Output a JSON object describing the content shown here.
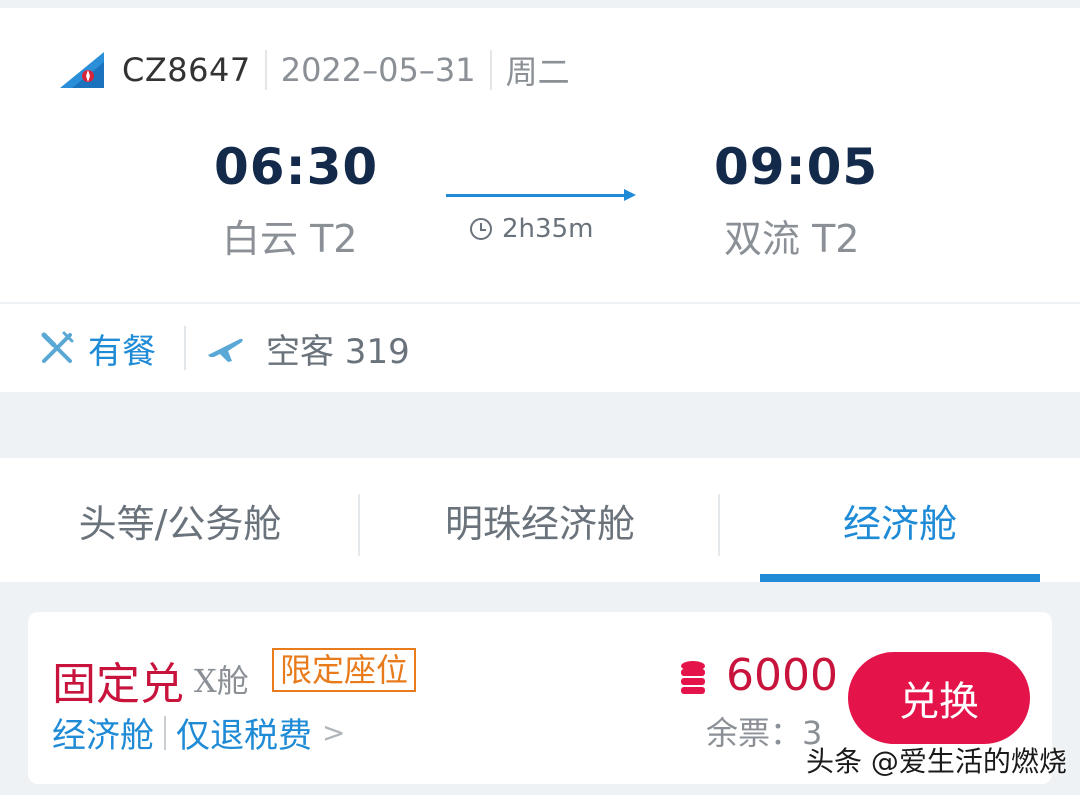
{
  "flight": {
    "number": "CZ8647",
    "date": "2022–05–31",
    "weekday": "周二",
    "departure_time": "06:30",
    "departure_airport": "白云 T2",
    "arrival_time": "09:05",
    "arrival_airport": "双流 T2",
    "duration": "2h35m",
    "logo_icon": "china-southern-logo",
    "accent_color": "#1f8bd6"
  },
  "info": {
    "meal": "有餐",
    "meal_icon": "fork-knife-icon",
    "aircraft": "空客 319",
    "aircraft_icon": "plane-icon"
  },
  "tabs": [
    {
      "label": "头等/公务舱",
      "selected": false
    },
    {
      "label": "明珠经济舱",
      "selected": false
    },
    {
      "label": "经济舱",
      "selected": true
    }
  ],
  "fare": {
    "title": "固定兑",
    "cabin": "X舱",
    "badge": "限定座位",
    "cabin_class": "经济舱",
    "refund_rule": "仅退税费",
    "chevron": ">",
    "coin_icon": "coin-stack-icon",
    "price": "6000",
    "remaining": "余票：3",
    "button_label": "兑换",
    "price_color": "#c8143c",
    "button_color": "#e4134a"
  },
  "watermark": "头条 @爱生活的燃烧"
}
